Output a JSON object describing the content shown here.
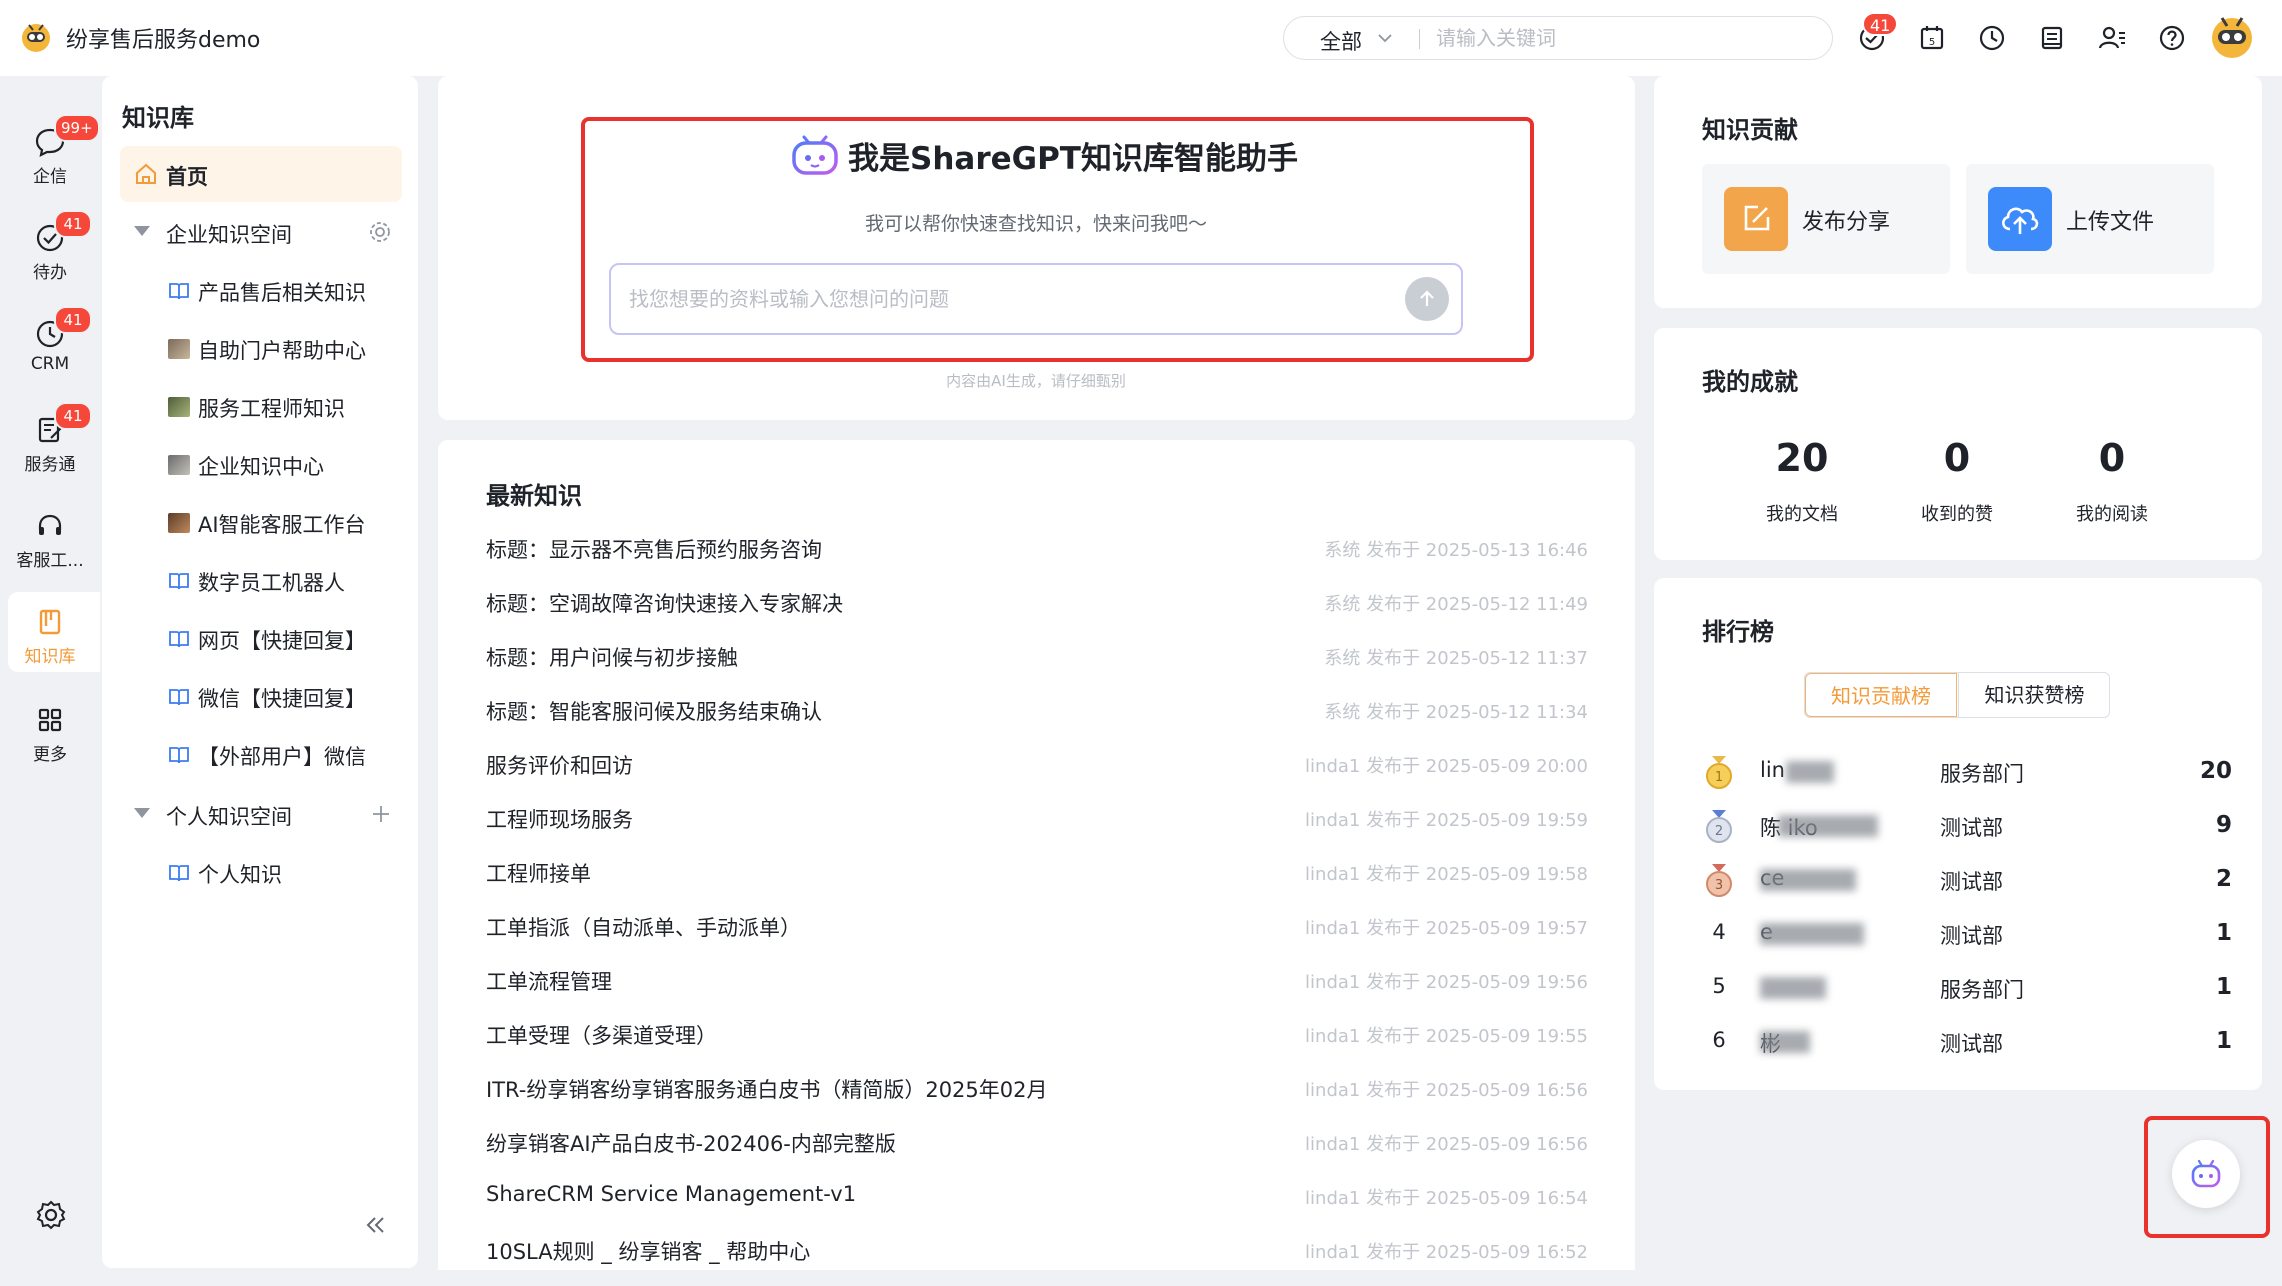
{
  "app": {
    "title": "纷享售后服务demo"
  },
  "topbar": {
    "search_scope": "全部",
    "search_placeholder": "请输入关键词",
    "notification_count": "41"
  },
  "rail": [
    {
      "label": "企信",
      "badge": "99+"
    },
    {
      "label": "待办",
      "badge": "41"
    },
    {
      "label": "CRM",
      "badge": "41"
    },
    {
      "label": "服务通",
      "badge": "41"
    },
    {
      "label": "客服工...",
      "badge": ""
    },
    {
      "label": "知识库",
      "badge": ""
    },
    {
      "label": "更多",
      "badge": ""
    }
  ],
  "sidenav": {
    "title": "知识库",
    "home": "首页",
    "enterprise_space": "企业知识空间",
    "enterprise_items": [
      "产品售后相关知识",
      "自助门户帮助中心",
      "服务工程师知识",
      "企业知识中心",
      "AI智能客服工作台",
      "数字员工机器人",
      "网页【快捷回复】",
      "微信【快捷回复】",
      "【外部用户】微信"
    ],
    "personal_space": "个人知识空间",
    "personal_items": [
      "个人知识"
    ]
  },
  "ai": {
    "title": "我是ShareGPT知识库智能助手",
    "subtitle": "我可以帮你快速查找知识，快来问我吧～",
    "placeholder": "找您想要的资料或输入您想问的问题",
    "disclaimer": "内容由AI生成，请仔细甄别"
  },
  "news": {
    "title": "最新知识",
    "items": [
      {
        "title": "标题：显示器不亮售后预约服务咨询",
        "meta": "系统 发布于 2025-05-13 16:46"
      },
      {
        "title": "标题：空调故障咨询快速接入专家解决",
        "meta": "系统 发布于 2025-05-12 11:49"
      },
      {
        "title": "标题：用户问候与初步接触",
        "meta": "系统 发布于 2025-05-12 11:37"
      },
      {
        "title": "标题：智能客服问候及服务结束确认",
        "meta": "系统 发布于 2025-05-12 11:34"
      },
      {
        "title": "服务评价和回访",
        "meta": "linda1 发布于 2025-05-09 20:00"
      },
      {
        "title": "工程师现场服务",
        "meta": "linda1 发布于 2025-05-09 19:59"
      },
      {
        "title": "工程师接单",
        "meta": "linda1 发布于 2025-05-09 19:58"
      },
      {
        "title": "工单指派（自动派单、手动派单）",
        "meta": "linda1 发布于 2025-05-09 19:57"
      },
      {
        "title": "工单流程管理",
        "meta": "linda1 发布于 2025-05-09 19:56"
      },
      {
        "title": "工单受理（多渠道受理）",
        "meta": "linda1 发布于 2025-05-09 19:55"
      },
      {
        "title": "ITR-纷享销客纷享销客服务通白皮书（精简版）2025年02月",
        "meta": "linda1 发布于 2025-05-09 16:56"
      },
      {
        "title": "纷享销客AI产品白皮书-202406-内部完整版",
        "meta": "linda1 发布于 2025-05-09 16:56"
      },
      {
        "title": "ShareCRM Service Management-v1",
        "meta": "linda1 发布于 2025-05-09 16:54"
      },
      {
        "title": "10SLA规则 _ 纷享销客 _ 帮助中心",
        "meta": "linda1 发布于 2025-05-09 16:52"
      }
    ]
  },
  "contrib": {
    "title": "知识贡献",
    "publish": "发布分享",
    "upload": "上传文件"
  },
  "achievement": {
    "title": "我的成就",
    "stats": [
      {
        "value": "20",
        "label": "我的文档"
      },
      {
        "value": "0",
        "label": "收到的赞"
      },
      {
        "value": "0",
        "label": "我的阅读"
      }
    ]
  },
  "ranking": {
    "title": "排行榜",
    "tab_active": "知识贡献榜",
    "tab_other": "知识获赞榜",
    "rows": [
      {
        "rank": "1",
        "name": "lin",
        "dept": "服务部门",
        "score": "20"
      },
      {
        "rank": "2",
        "name": "陈          iko",
        "dept": "测试部",
        "score": "9"
      },
      {
        "rank": "3",
        "name": "          ce",
        "dept": "测试部",
        "score": "2"
      },
      {
        "rank": "4",
        "name": "          e",
        "dept": "测试部",
        "score": "1"
      },
      {
        "rank": "5",
        "name": "",
        "dept": "服务部门",
        "score": "1"
      },
      {
        "rank": "6",
        "name": "          彬",
        "dept": "测试部",
        "score": "1"
      }
    ]
  },
  "colors": {
    "accent_orange": "#f39a39",
    "publish_tile": "#f2a54a",
    "upload_tile": "#3d8bfa",
    "badge_red": "#f5483b",
    "highlight_red": "#e8322b"
  }
}
